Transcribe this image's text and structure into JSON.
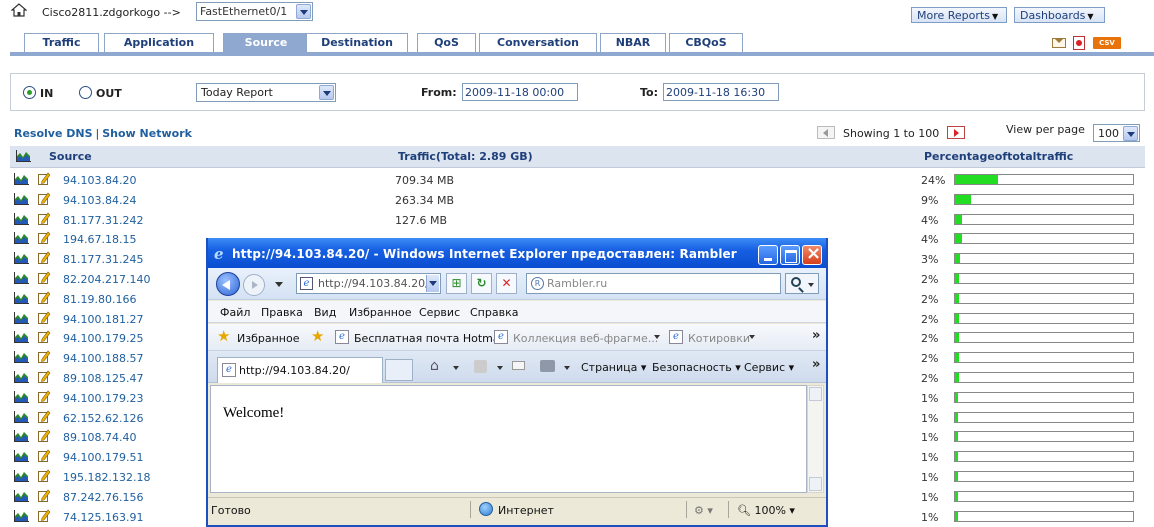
{
  "header": {
    "device": "Cisco2811.zdgorkogo -->",
    "interface": "FastEthernet0/1",
    "more_reports": "More Reports",
    "dashboards": "Dashboards"
  },
  "tabs": [
    {
      "label": "Traffic",
      "active": false
    },
    {
      "label": "Application",
      "active": false
    },
    {
      "label": "Source",
      "active": true
    },
    {
      "label": "Destination",
      "active": false
    },
    {
      "label": "QoS",
      "active": false
    },
    {
      "label": "Conversation",
      "active": false
    },
    {
      "label": "NBAR",
      "active": false
    },
    {
      "label": "CBQoS",
      "active": false
    }
  ],
  "toolbar_icons": {
    "email": "email-icon",
    "pdf": "pdf-icon",
    "csv": "CSV"
  },
  "filters": {
    "in_label": "IN",
    "out_label": "OUT",
    "selected_direction": "IN",
    "report": "Today Report",
    "from_label": "From:",
    "from_value": "2009-11-18 00:00",
    "to_label": "To:",
    "to_value": "2009-11-18 16:30"
  },
  "results": {
    "resolve_dns": "Resolve DNS",
    "separator": "|",
    "show_network": "Show Network",
    "showing": "Showing 1 to 100",
    "view_per_page_label": "View per page",
    "view_per_page": "100"
  },
  "table": {
    "headers": {
      "source": "Source",
      "traffic": "Traffic(Total: 2.89 GB)",
      "percentage": "Percentageoftotaltraffic"
    },
    "rows": [
      {
        "source": "94.103.84.20",
        "traffic": "709.34 MB",
        "percent": "24%",
        "fill": 24
      },
      {
        "source": "94.103.84.24",
        "traffic": "263.34 MB",
        "percent": "9%",
        "fill": 9
      },
      {
        "source": "81.177.31.242",
        "traffic": "127.6 MB",
        "percent": "4%",
        "fill": 4
      },
      {
        "source": "194.67.18.15",
        "traffic": "",
        "percent": "4%",
        "fill": 4
      },
      {
        "source": "81.177.31.245",
        "traffic": "",
        "percent": "3%",
        "fill": 3
      },
      {
        "source": "82.204.217.140",
        "traffic": "",
        "percent": "2%",
        "fill": 2
      },
      {
        "source": "81.19.80.166",
        "traffic": "",
        "percent": "2%",
        "fill": 2
      },
      {
        "source": "94.100.181.27",
        "traffic": "",
        "percent": "2%",
        "fill": 2
      },
      {
        "source": "94.100.179.25",
        "traffic": "",
        "percent": "2%",
        "fill": 2
      },
      {
        "source": "94.100.188.57",
        "traffic": "",
        "percent": "2%",
        "fill": 2
      },
      {
        "source": "89.108.125.47",
        "traffic": "",
        "percent": "2%",
        "fill": 2
      },
      {
        "source": "94.100.179.23",
        "traffic": "",
        "percent": "1%",
        "fill": 1
      },
      {
        "source": "62.152.62.126",
        "traffic": "",
        "percent": "1%",
        "fill": 1
      },
      {
        "source": "89.108.74.40",
        "traffic": "",
        "percent": "1%",
        "fill": 1
      },
      {
        "source": "94.100.179.51",
        "traffic": "",
        "percent": "1%",
        "fill": 1
      },
      {
        "source": "195.182.132.18",
        "traffic": "",
        "percent": "1%",
        "fill": 1
      },
      {
        "source": "87.242.76.156",
        "traffic": "",
        "percent": "1%",
        "fill": 1
      },
      {
        "source": "74.125.163.91",
        "traffic": "",
        "percent": "1%",
        "fill": 1
      }
    ]
  },
  "ie_window": {
    "title": "http://94.103.84.20/ - Windows Internet Explorer предоставлен: Rambler",
    "address": "http://94.103.84.20/",
    "search_placeholder": "Rambler.ru",
    "menu": [
      "Файл",
      "Правка",
      "Вид",
      "Избранное",
      "Сервис",
      "Справка"
    ],
    "favorites_label": "Избранное",
    "favorites": [
      "Бесплатная почта Hotmail",
      "Коллекция веб-фрагме...",
      "Котировки"
    ],
    "tab_label": "http://94.103.84.20/",
    "commands": [
      "Страница",
      "Безопасность",
      "Сервис"
    ],
    "content_text": "Welcome!",
    "status": "Готово",
    "zone": "Интернет",
    "zoom": "100%"
  },
  "colors": {
    "tab_active": "#8fa8cf",
    "link": "#1f5f9f",
    "bar_fill": "#22dd22",
    "ie_title": "#1760e3"
  }
}
